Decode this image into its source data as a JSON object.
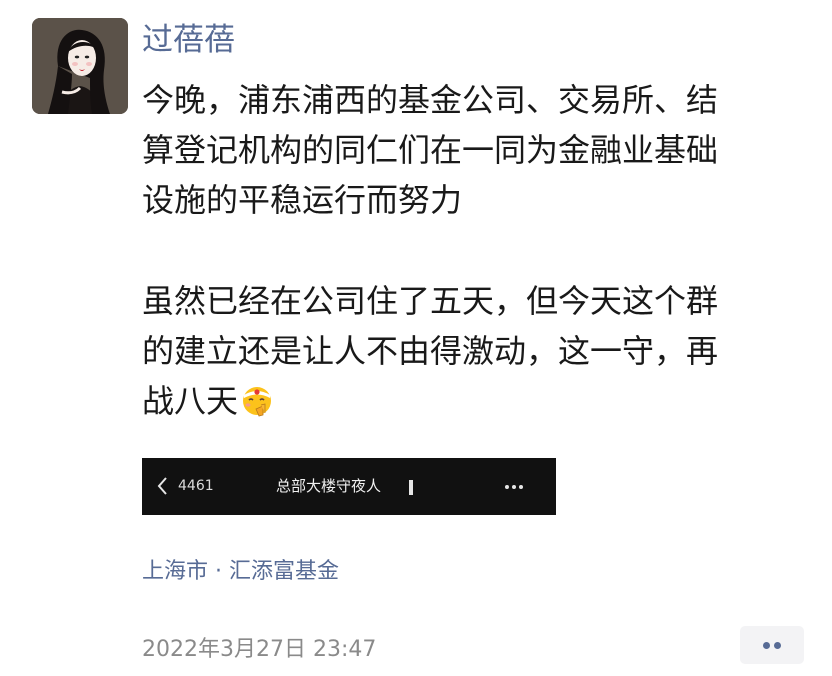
{
  "post": {
    "username": "过蓓蓓",
    "avatar": "avatar-woman-illustration",
    "paragraphs": [
      {
        "lines": [
          "今晚，浦东浦西的基金公司、交易所、结",
          "算登记机构的同仁们在一同为金融业基础",
          "设施的平稳运行而努力"
        ]
      },
      {
        "lines": [
          "虽然已经在公司住了五天，但今天这个群",
          "的建立还是让人不由得激动，这一守，再",
          "战八天"
        ],
        "trailing_emoji": "saluting-face-with-headband-emoji"
      }
    ],
    "embed": {
      "back_icon": "chevron-left-icon",
      "count": "4461",
      "group_name": "总部大楼守夜人",
      "more_icon": "more-dots-icon"
    },
    "location": "上海市 · 汇添富基金",
    "timestamp": "2022年3月27日 23:47",
    "action_icon": "comment-dots-icon"
  },
  "colors": {
    "link_blue": "#576b95",
    "text": "#191919",
    "meta_gray": "#8a8a8a",
    "embed_bg": "#111111"
  }
}
